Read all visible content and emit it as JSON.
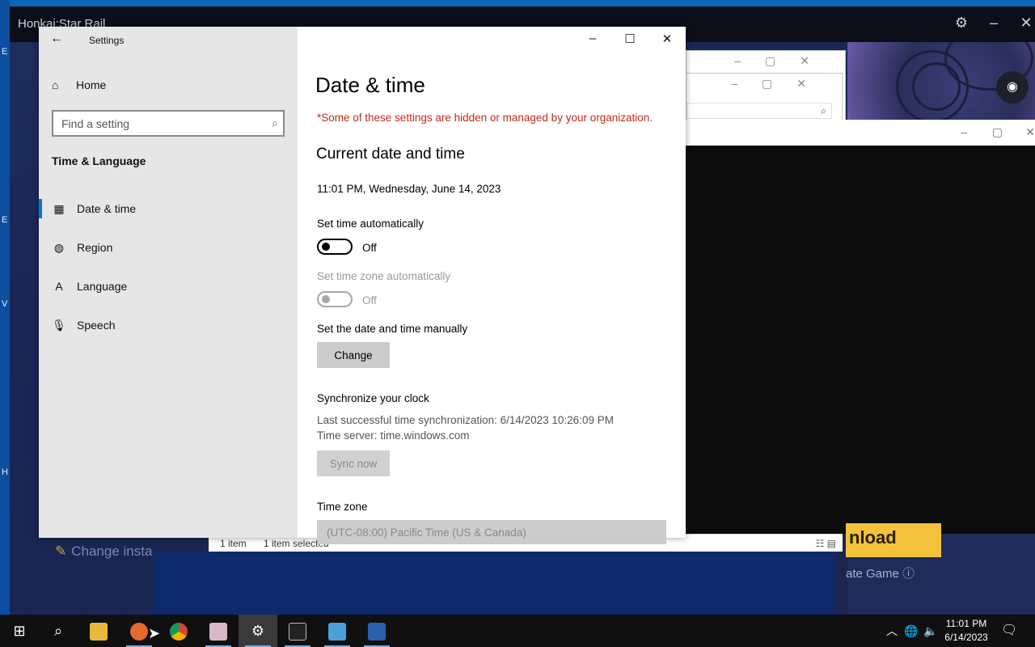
{
  "background": {
    "launcher_title": "Honkai:Star Rail",
    "download_label": "nload",
    "update_game_label": "ate Game",
    "change_install_label": "Change insta",
    "edge_letters": [
      "E",
      "E",
      "V",
      "H"
    ],
    "explorer_status": {
      "items": "1 item",
      "selected": "1 item selected"
    }
  },
  "settings": {
    "app_title": "Settings",
    "home_label": "Home",
    "search": {
      "placeholder": "Find a setting"
    },
    "section_title": "Time & Language",
    "nav_items": [
      {
        "label": "Date & time",
        "icon": "calendar-clock-icon",
        "active": true
      },
      {
        "label": "Region",
        "icon": "globe-icon",
        "active": false
      },
      {
        "label": "Language",
        "icon": "language-icon",
        "active": false
      },
      {
        "label": "Speech",
        "icon": "microphone-icon",
        "active": false
      }
    ],
    "page_title": "Date & time",
    "org_note": "*Some of these settings are hidden or managed by your organization.",
    "current_heading": "Current date and time",
    "current_datetime": "11:01 PM, Wednesday, June 14, 2023",
    "set_time_auto": {
      "label": "Set time automatically",
      "state": "Off"
    },
    "set_tz_auto": {
      "label": "Set time zone automatically",
      "state": "Off"
    },
    "manual": {
      "label": "Set the date and time manually",
      "button": "Change"
    },
    "sync": {
      "heading": "Synchronize your clock",
      "last_sync": "Last successful time synchronization: 6/14/2023 10:26:09 PM",
      "server": "Time server: time.windows.com",
      "button": "Sync now"
    },
    "timezone": {
      "label": "Time zone",
      "value": "(UTC-08:00) Pacific Time (US & Canada)"
    }
  },
  "taskbar": {
    "clock_time": "11:01 PM",
    "clock_date": "6/14/2023",
    "apps": [
      "start-icon",
      "search-icon",
      "file-explorer-icon",
      "firefox-icon",
      "chrome-icon",
      "game-launcher-icon",
      "settings-icon",
      "terminal-icon",
      "control-panel-icon",
      "powershell-icon"
    ]
  },
  "colors": {
    "accent": "#0078d7",
    "warning": "#c42b1c",
    "taskbar": "#101010",
    "sidebar": "#e6e6e6"
  }
}
